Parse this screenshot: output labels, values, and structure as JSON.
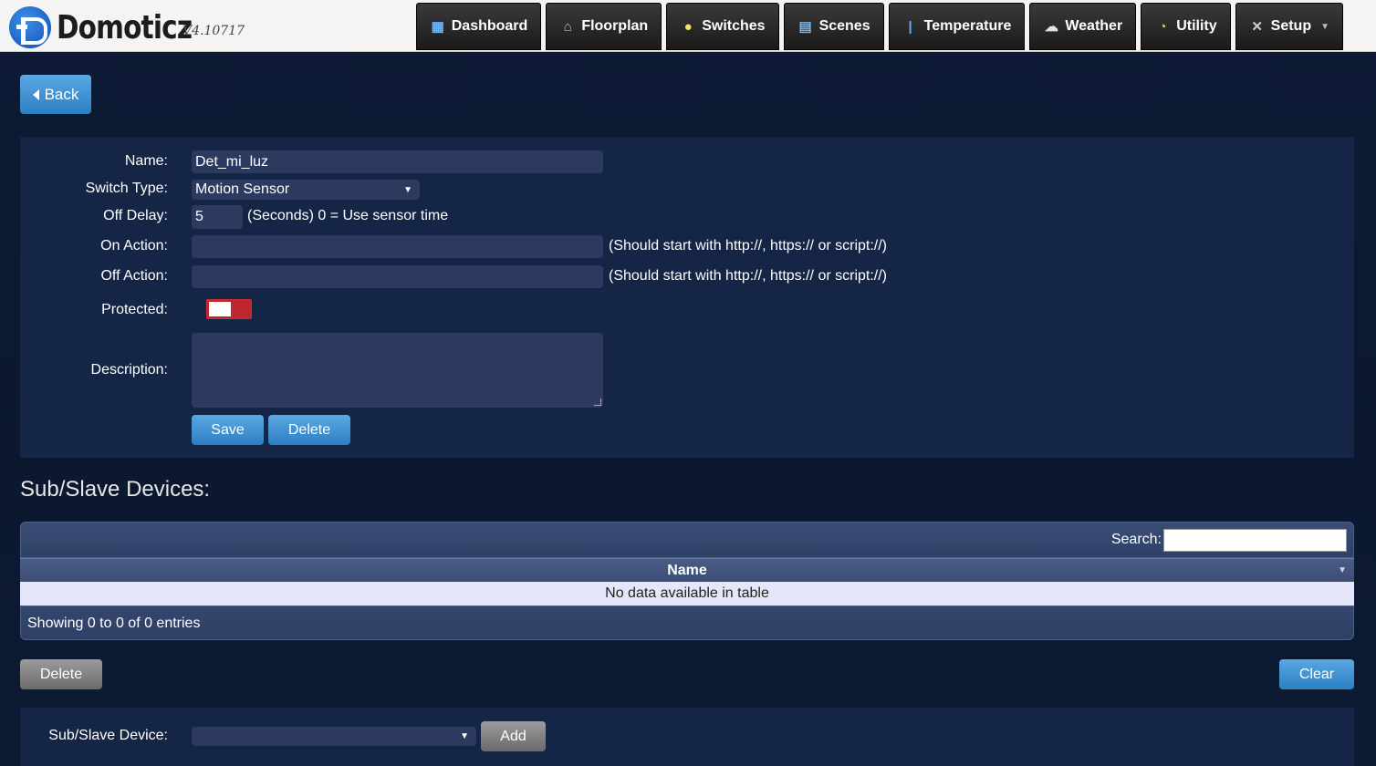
{
  "app": {
    "name": "Domoticz",
    "version": "V4.10717"
  },
  "nav": [
    {
      "label": "Dashboard",
      "icon": "dashboard-icon",
      "glyph": "▦"
    },
    {
      "label": "Floorplan",
      "icon": "house-icon",
      "glyph": "⌂"
    },
    {
      "label": "Switches",
      "icon": "bulb-icon",
      "glyph": "●"
    },
    {
      "label": "Scenes",
      "icon": "clapper-icon",
      "glyph": "▤"
    },
    {
      "label": "Temperature",
      "icon": "thermometer-icon",
      "glyph": "🌡"
    },
    {
      "label": "Weather",
      "icon": "cloud-icon",
      "glyph": "☁"
    },
    {
      "label": "Utility",
      "icon": "gauge-icon",
      "glyph": "◔"
    },
    {
      "label": "Setup",
      "icon": "tools-icon",
      "glyph": "✕"
    }
  ],
  "back_label": "Back",
  "form": {
    "name_label": "Name:",
    "name_value": "Det_mi_luz",
    "switch_type_label": "Switch Type:",
    "switch_type_value": "Motion Sensor",
    "off_delay_label": "Off Delay:",
    "off_delay_value": "5",
    "off_delay_hint": "(Seconds) 0 = Use sensor time",
    "on_action_label": "On Action:",
    "on_action_value": "",
    "on_action_hint": "(Should start with http://, https:// or script://)",
    "off_action_label": "Off Action:",
    "off_action_value": "",
    "off_action_hint": "(Should start with http://, https:// or script://)",
    "protected_label": "Protected:",
    "protected_on": false,
    "description_label": "Description:",
    "description_value": "",
    "save_label": "Save",
    "delete_label": "Delete"
  },
  "sub_devices": {
    "title": "Sub/Slave Devices:",
    "search_label": "Search:",
    "column_name": "Name",
    "empty_text": "No data available in table",
    "info_text": "Showing 0 to 0 of 0 entries",
    "delete_label": "Delete",
    "clear_label": "Clear",
    "device_label": "Sub/Slave Device:",
    "device_value": "",
    "add_label": "Add"
  },
  "colors": {
    "background": "#0e1b36",
    "panel": "#152545",
    "input": "#2b3a5e",
    "accent_blue": "#2d7fc3",
    "toggle_off": "#c0262d"
  }
}
